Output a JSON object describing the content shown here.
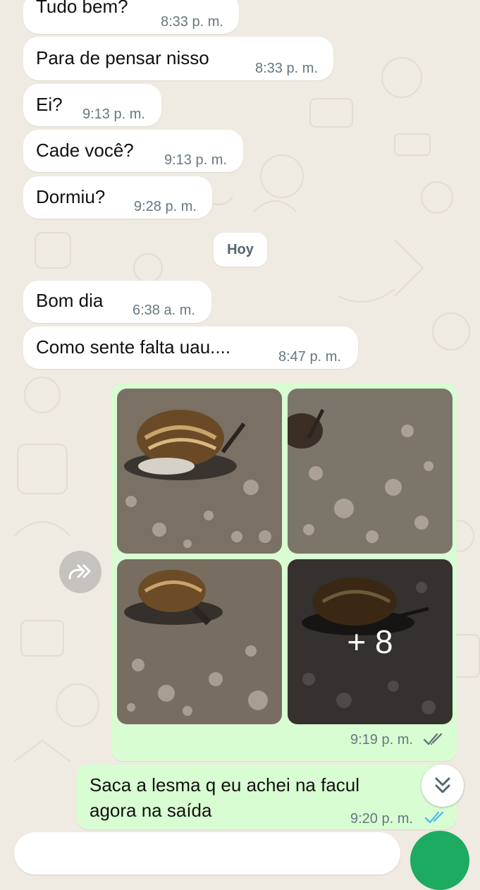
{
  "messages": [
    {
      "text": "Tudo bem?",
      "time": "8:33 p. m."
    },
    {
      "text": "Para de pensar nisso",
      "time": "8:33 p. m."
    },
    {
      "text": "Ei?",
      "time": "9:13 p. m."
    },
    {
      "text": "Cade você?",
      "time": "9:13 p. m."
    },
    {
      "text": "Dormiu?",
      "time": "9:28 p. m."
    },
    {
      "text": "Bom dia",
      "time": "6:38 a. m."
    },
    {
      "text": "Como sente falta uau....",
      "time": "8:47 p. m."
    }
  ],
  "day_separator": "Hoy",
  "album": {
    "more_count_label": "+ 8",
    "time": "9:19 p. m.",
    "status": "delivered",
    "photos": [
      "snail-photo",
      "snail-photo",
      "snail-photo",
      "snail-photo"
    ]
  },
  "outgoing": {
    "line1": "Saca a lesma q eu achei na facul",
    "line2": "agora na saída",
    "time": "9:20 p. m.",
    "status": "read"
  },
  "colors": {
    "chat_bg": "#efeae2",
    "incoming_bubble": "#ffffff",
    "outgoing_bubble": "#d9fdd3",
    "read_tick": "#53bdeb",
    "delivered_tick": "#667781",
    "send_button": "#1daa61"
  },
  "icons": [
    "forward-icon",
    "scroll-down-icon",
    "double-check-icon"
  ]
}
